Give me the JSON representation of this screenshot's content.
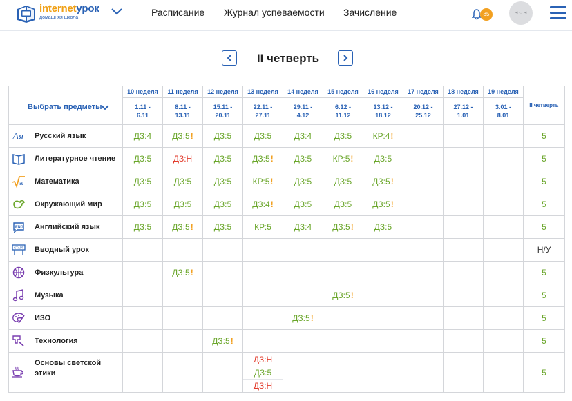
{
  "header": {
    "logo_brand_part1": "internet",
    "logo_brand_part2": "урок",
    "logo_sub": "домашняя школа",
    "nav": [
      "Расписание",
      "Журнал успеваемости",
      "Зачисление"
    ],
    "notifications_count": "85",
    "avatar_text": "◄ ○ ◄",
    "accent_color": "#2a62b5",
    "badge_color": "#f2a020"
  },
  "quarter": {
    "title": "II четверть"
  },
  "grid": {
    "select_label": "Выбрать предметы",
    "weeks": [
      {
        "label": "10 неделя",
        "dates": "1.11 -\n6.11"
      },
      {
        "label": "11 неделя",
        "dates": "8.11 -\n13.11"
      },
      {
        "label": "12 неделя",
        "dates": "15.11 -\n20.11"
      },
      {
        "label": "13 неделя",
        "dates": "22.11 -\n27.11"
      },
      {
        "label": "14 неделя",
        "dates": "29.11 -\n4.12"
      },
      {
        "label": "15 неделя",
        "dates": "6.12 -\n11.12"
      },
      {
        "label": "16 неделя",
        "dates": "13.12 -\n18.12"
      },
      {
        "label": "17 неделя",
        "dates": "20.12 -\n25.12"
      },
      {
        "label": "18 неделя",
        "dates": "27.12 -\n1.01"
      },
      {
        "label": "19 неделя",
        "dates": "3.01 -\n8.01"
      }
    ],
    "quarter_col_label": "II четверть",
    "subjects": [
      {
        "name": "Русский язык",
        "icon": "russian-language-icon",
        "grades": [
          "ДЗ:4",
          "ДЗ:5!",
          "ДЗ:5",
          "ДЗ:5",
          "ДЗ:4",
          "ДЗ:5",
          "КР:4!",
          "",
          "",
          ""
        ],
        "quarter": "5"
      },
      {
        "name": "Литературное чтение",
        "icon": "open-book-icon",
        "grades": [
          "ДЗ:5",
          "ДЗ:Н",
          "ДЗ:5",
          "ДЗ:5!",
          "ДЗ:5",
          "КР:5!",
          "ДЗ:5",
          "",
          "",
          ""
        ],
        "quarter": "5"
      },
      {
        "name": "Математика",
        "icon": "math-sqrt-icon",
        "grades": [
          "ДЗ:5",
          "ДЗ:5",
          "ДЗ:5",
          "КР:5!",
          "ДЗ:5",
          "ДЗ:5",
          "ДЗ:5!",
          "",
          "",
          ""
        ],
        "quarter": "5"
      },
      {
        "name": "Окружающий мир",
        "icon": "bird-icon",
        "grades": [
          "ДЗ:5",
          "ДЗ:5",
          "ДЗ:5",
          "ДЗ:4!",
          "ДЗ:5",
          "ДЗ:5",
          "ДЗ:5!",
          "",
          "",
          ""
        ],
        "quarter": "5"
      },
      {
        "name": "Английский язык",
        "icon": "english-eng-icon",
        "grades": [
          "ДЗ:5",
          "ДЗ:5!",
          "ДЗ:5",
          "КР:5",
          "ДЗ:4",
          "ДЗ:5!",
          "ДЗ:5",
          "",
          "",
          ""
        ],
        "quarter": "5"
      },
      {
        "name": "Вводный урок",
        "icon": "start-sign-icon",
        "grades": [
          "",
          "",
          "",
          "",
          "",
          "",
          "",
          "",
          "",
          ""
        ],
        "quarter": "Н/У"
      },
      {
        "name": "Физкультура",
        "icon": "basketball-icon",
        "grades": [
          "",
          "ДЗ:5!",
          "",
          "",
          "",
          "",
          "",
          "",
          "",
          ""
        ],
        "quarter": "5"
      },
      {
        "name": "Музыка",
        "icon": "music-note-icon",
        "grades": [
          "",
          "",
          "",
          "",
          "",
          "ДЗ:5!",
          "",
          "",
          "",
          ""
        ],
        "quarter": "5"
      },
      {
        "name": "ИЗО",
        "icon": "palette-brush-icon",
        "grades": [
          "",
          "",
          "",
          "",
          "ДЗ:5!",
          "",
          "",
          "",
          "",
          ""
        ],
        "quarter": "5"
      },
      {
        "name": "Технология",
        "icon": "tools-icon",
        "grades": [
          "",
          "",
          "ДЗ:5!",
          "",
          "",
          "",
          "",
          "",
          "",
          ""
        ],
        "quarter": "5"
      },
      {
        "name": "Основы светской этики",
        "icon": "teacup-icon",
        "grades": [
          "",
          "",
          "",
          "ДЗ:Н|ДЗ:5|ДЗ:Н",
          "",
          "",
          "",
          "",
          "",
          ""
        ],
        "quarter": "5"
      }
    ],
    "grade_color": "#6aa62a",
    "absent_color": "#e23b2c",
    "warning_color": "#f2a020"
  }
}
